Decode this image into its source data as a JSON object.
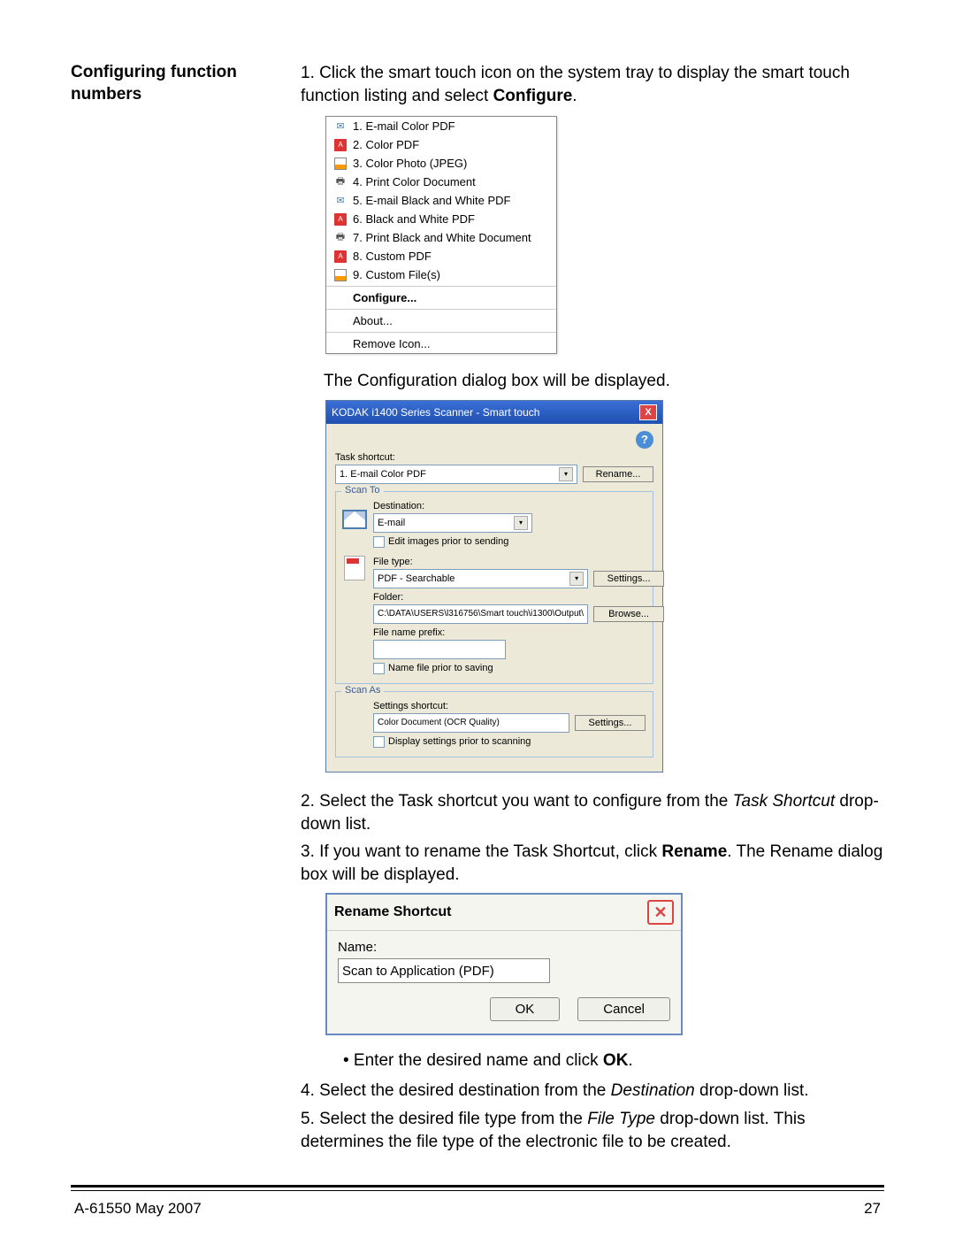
{
  "section_title": "Configuring function numbers",
  "step1_a": "1.  Click the smart touch icon on the system tray to display the smart touch function listing and select ",
  "step1_b": "Configure",
  "step1_c": ".",
  "menu_items": [
    "1. E-mail Color PDF",
    "2. Color PDF",
    "3. Color Photo (JPEG)",
    "4. Print Color Document",
    "5. E-mail Black and White PDF",
    "6. Black and White PDF",
    "7. Print Black and White Document",
    "8. Custom PDF",
    "9. Custom File(s)"
  ],
  "menu_configure": "Configure...",
  "menu_about": "About...",
  "menu_remove": "Remove Icon...",
  "after_menu": "The Configuration dialog box will be displayed.",
  "config": {
    "title": "KODAK i1400 Series Scanner - Smart touch",
    "task_shortcut_label": "Task shortcut:",
    "task_shortcut_value": "1. E-mail Color PDF",
    "rename_btn": "Rename...",
    "scan_to_legend": "Scan To",
    "destination_label": "Destination:",
    "destination_value": "E-mail",
    "edit_images_check": "Edit images prior to sending",
    "filetype_label": "File type:",
    "filetype_value": "PDF - Searchable",
    "settings_btn": "Settings...",
    "folder_label": "Folder:",
    "folder_value": "C:\\DATA\\USERS\\l316756\\Smart touch\\i1300\\Output\\",
    "browse_btn": "Browse...",
    "prefix_label": "File name prefix:",
    "name_file_check": "Name file prior to saving",
    "scan_as_legend": "Scan As",
    "settings_shortcut_label": "Settings shortcut:",
    "settings_shortcut_value": "Color Document (OCR Quality)",
    "display_settings_check": "Display settings prior to scanning"
  },
  "step2_a": "2.  Select the Task shortcut you want to configure from the ",
  "step2_b": "Task Shortcut",
  "step2_c": " drop-down list.",
  "step3_a": "3.  If you want to rename the Task Shortcut, click ",
  "step3_b": "Rename",
  "step3_c": ". The Rename dialog box will be displayed.",
  "rename": {
    "title": "Rename Shortcut",
    "name_label": "Name:",
    "name_value": "Scan to Application (PDF)",
    "ok": "OK",
    "cancel": "Cancel"
  },
  "bullet_a": "•   Enter the desired name and click ",
  "bullet_b": "OK",
  "bullet_c": ".",
  "step4_a": "4.  Select the desired destination from the ",
  "step4_b": "Destination",
  "step4_c": " drop-down list.",
  "step5_a": "5.  Select the desired file type from the ",
  "step5_b": "File Type",
  "step5_c": " drop-down list. This determines the file type of the electronic file to be created.",
  "footer_left": "A-61550  May 2007",
  "footer_right": "27"
}
